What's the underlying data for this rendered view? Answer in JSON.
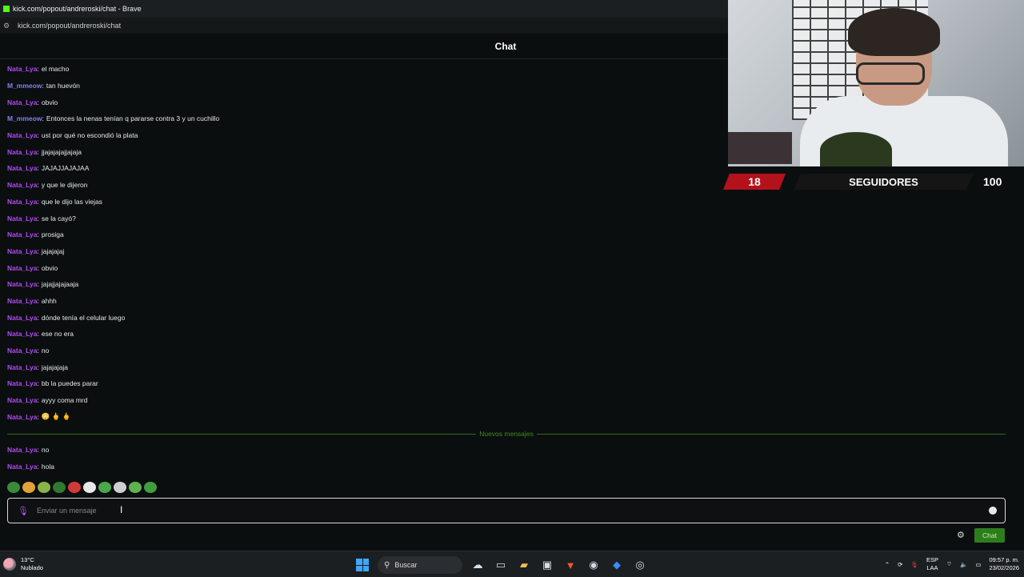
{
  "window": {
    "title": "kick.com/popout/andreroski/chat - Brave",
    "url": "kick.com/popout/andreroski/chat"
  },
  "chat": {
    "header": "Chat",
    "messages": [
      {
        "user": "Nata_Lya",
        "color": "#b14cf0",
        "text": "el macho"
      },
      {
        "user": "M_mmeow",
        "color": "#7b85f0",
        "text": "tan huevón"
      },
      {
        "user": "Nata_Lya",
        "color": "#b14cf0",
        "text": "obvio"
      },
      {
        "user": "M_mmeow",
        "color": "#7b85f0",
        "text": "Entonces la nenas tenían q pararse contra 3 y un cuchillo"
      },
      {
        "user": "Nata_Lya",
        "color": "#b14cf0",
        "text": "ust por qué no escondió la plata"
      },
      {
        "user": "Nata_Lya",
        "color": "#b14cf0",
        "text": "jjajajajajjajaja"
      },
      {
        "user": "Nata_Lya",
        "color": "#b14cf0",
        "text": "JAJAJJAJAJAA"
      },
      {
        "user": "Nata_Lya",
        "color": "#b14cf0",
        "text": "y que le dijeron"
      },
      {
        "user": "Nata_Lya",
        "color": "#b14cf0",
        "text": "que le dijo las viejas"
      },
      {
        "user": "Nata_Lya",
        "color": "#b14cf0",
        "text": "se la cayó?"
      },
      {
        "user": "Nata_Lya",
        "color": "#b14cf0",
        "text": "prosiga"
      },
      {
        "user": "Nata_Lya",
        "color": "#b14cf0",
        "text": "jajajajaj"
      },
      {
        "user": "Nata_Lya",
        "color": "#b14cf0",
        "text": "obvio"
      },
      {
        "user": "Nata_Lya",
        "color": "#b14cf0",
        "text": "jajajjajajaaja"
      },
      {
        "user": "Nata_Lya",
        "color": "#b14cf0",
        "text": "ahhh"
      },
      {
        "user": "Nata_Lya",
        "color": "#b14cf0",
        "text": "dónde tenía el celular luego"
      },
      {
        "user": "Nata_Lya",
        "color": "#b14cf0",
        "text": "ese no era"
      },
      {
        "user": "Nata_Lya",
        "color": "#b14cf0",
        "text": "no"
      },
      {
        "user": "Nata_Lya",
        "color": "#b14cf0",
        "text": "jajajajaja"
      },
      {
        "user": "Nata_Lya",
        "color": "#b14cf0",
        "text": "bb la puedes parar"
      },
      {
        "user": "Nata_Lya",
        "color": "#b14cf0",
        "text": "ayyy coma mrd"
      },
      {
        "user": "Nata_Lya",
        "color": "#b14cf0",
        "text": "😳 🖕 🖕"
      }
    ],
    "new_messages_label": "Nuevos mensajes",
    "new_messages": [
      {
        "user": "Nata_Lya",
        "color": "#b14cf0",
        "text": "no"
      },
      {
        "user": "Nata_Lya",
        "color": "#b14cf0",
        "text": "hola"
      }
    ],
    "emote_bar": [
      {
        "name": "pepe-emote",
        "color": "#3a8a3a"
      },
      {
        "name": "emote-2",
        "color": "#e2a13a"
      },
      {
        "name": "emote-3",
        "color": "#8ab34a"
      },
      {
        "name": "emote-4",
        "color": "#2f7a2f"
      },
      {
        "name": "emote-5",
        "color": "#d23a3a"
      },
      {
        "name": "emote-6",
        "color": "#e8e8e8"
      },
      {
        "name": "emote-7",
        "color": "#4aa84a"
      },
      {
        "name": "emote-8",
        "color": "#cfcfcf"
      },
      {
        "name": "emote-9",
        "color": "#5fb34f"
      },
      {
        "name": "emote-10",
        "color": "#3f9f3f"
      }
    ],
    "input_placeholder": "Enviar un mensaje",
    "send_button": "Chat"
  },
  "overlay": {
    "followers_count": "18",
    "followers_label": "SEGUIDORES",
    "followers_goal": "100"
  },
  "taskbar": {
    "temperature": "13°C",
    "weather": "Nublado",
    "search_label": "Buscar",
    "lang_top": "ESP",
    "lang_bottom": "LAA",
    "time": "09:57 p. m.",
    "date": "23/02/2026"
  }
}
